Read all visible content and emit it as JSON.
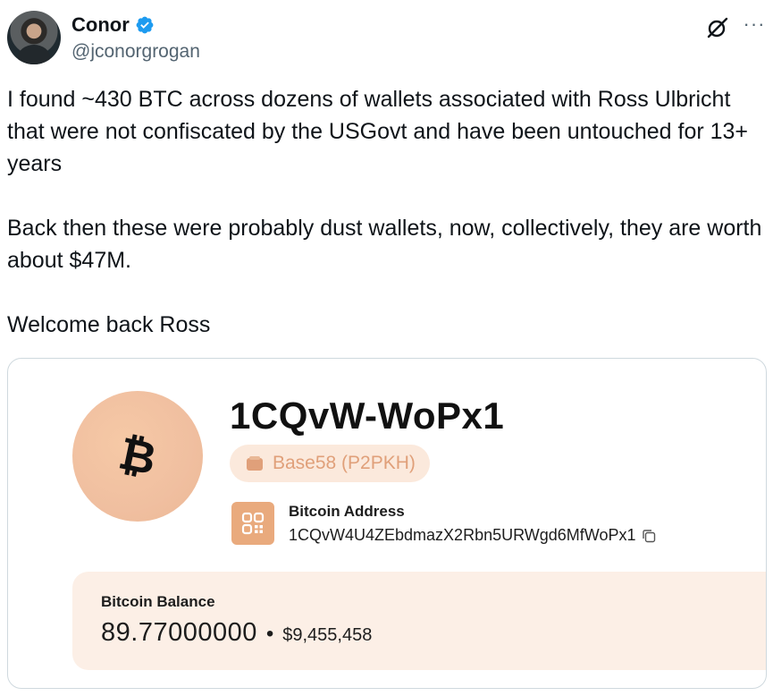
{
  "author": {
    "name": "Conor",
    "handle": "@jconorgrogan",
    "verified": true
  },
  "tweet": {
    "paragraphs": [
      "I found ~430 BTC across dozens of wallets associated with Ross Ulbricht that were not confiscated by the USGovt and have been untouched for 13+ years",
      "Back then these were probably dust wallets, now, collectively, they are worth about $47M.",
      "Welcome back Ross"
    ]
  },
  "card": {
    "coin_symbol": "₿",
    "address_short": "1CQvW-WoPx1",
    "address_type": "Base58 (P2PKH)",
    "address_label": "Bitcoin Address",
    "address_full": "1CQvW4U4ZEbdmazX2Rbn5URWgd6MfWoPx1",
    "balance_label": "Bitcoin Balance",
    "balance_btc": "89.77000000",
    "balance_separator": "•",
    "balance_usd": "$9,455,458"
  },
  "colors": {
    "verified": "#1d9bf0",
    "accent_orange": "#e9aa7d",
    "tag_bg": "#fbe9dc",
    "balance_bg": "#fcefe6"
  },
  "icons": {
    "verified": "verified-badge-icon",
    "grok": "grok-icon",
    "more": "more-icon",
    "wallet": "wallet-icon",
    "qr": "qr-code-icon",
    "copy": "copy-icon",
    "bitcoin": "bitcoin-icon"
  }
}
